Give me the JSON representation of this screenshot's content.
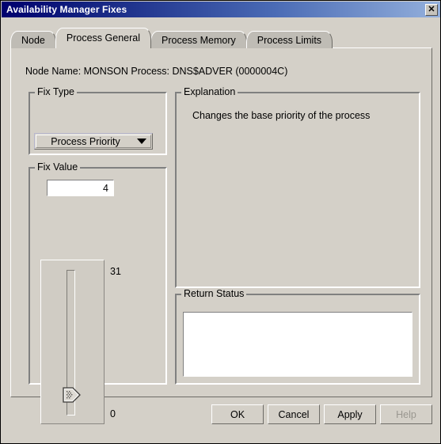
{
  "window": {
    "title": "Availability Manager Fixes",
    "close_label": "✕"
  },
  "tabs": [
    {
      "label": "Node",
      "selected": false
    },
    {
      "label": "Process General",
      "selected": true
    },
    {
      "label": "Process Memory",
      "selected": false
    },
    {
      "label": "Process Limits",
      "selected": false
    }
  ],
  "info": {
    "line": "Node Name:  MONSON  Process:  DNS$ADVER (0000004C)",
    "node_name_label": "Node Name:",
    "node_name_value": "MONSON",
    "process_label": "Process:",
    "process_value": "DNS$ADVER (0000004C)"
  },
  "fix_type": {
    "group_title": "Fix Type",
    "selected": "Process Priority",
    "options": [
      "Process Priority"
    ]
  },
  "fix_value": {
    "group_title": "Fix Value",
    "value": "4",
    "slider": {
      "max_label": "31",
      "min_label": "0",
      "min": 0,
      "max": 31,
      "value": 4,
      "orientation": "vertical"
    }
  },
  "explanation": {
    "group_title": "Explanation",
    "text": "Changes the base priority of the process"
  },
  "return_status": {
    "group_title": "Return Status",
    "text": ""
  },
  "buttons": [
    {
      "label": "OK",
      "enabled": true
    },
    {
      "label": "Cancel",
      "enabled": true
    },
    {
      "label": "Apply",
      "enabled": true
    },
    {
      "label": "Help",
      "enabled": false
    }
  ],
  "colors": {
    "dialog_face": "#d4d0c8",
    "title_gradient_start": "#00006e",
    "title_gradient_end": "#94b0dc",
    "field_background": "#ffffff",
    "disabled_text": "#9a9790"
  }
}
